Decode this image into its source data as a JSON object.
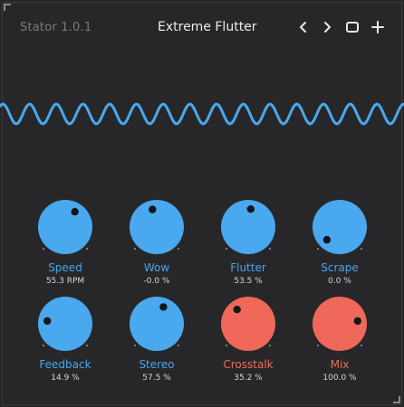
{
  "header": {
    "app_version": "Stator 1.0.1",
    "preset_name": "Extreme Flutter",
    "icons": [
      "chevron-left-icon",
      "chevron-right-icon",
      "window-icon",
      "plus-icon"
    ]
  },
  "colors": {
    "background": "#272729",
    "accent_blue": "#4aa8ee",
    "accent_red": "#f0685a",
    "wave": "#4aa8ee"
  },
  "knobs": [
    {
      "label": "Speed",
      "value": "55.3 RPM",
      "color": "blue",
      "level": 0.62
    },
    {
      "label": "Wow",
      "value": "-0.0 %",
      "color": "blue",
      "level": 0.45
    },
    {
      "label": "Flutter",
      "value": "53.5 %",
      "color": "blue",
      "level": 0.53
    },
    {
      "label": "Scrape",
      "value": "0.0 %",
      "color": "blue",
      "level": 0.0
    },
    {
      "label": "Feedback",
      "value": "14.9 %",
      "color": "blue",
      "level": 0.2
    },
    {
      "label": "Stereo",
      "value": "57.5 %",
      "color": "blue",
      "level": 0.58
    },
    {
      "label": "Crosstalk",
      "value": "35.2 %",
      "color": "red",
      "level": 0.36
    },
    {
      "label": "Mix",
      "value": "100.0 %",
      "color": "red",
      "level": 0.8
    }
  ]
}
